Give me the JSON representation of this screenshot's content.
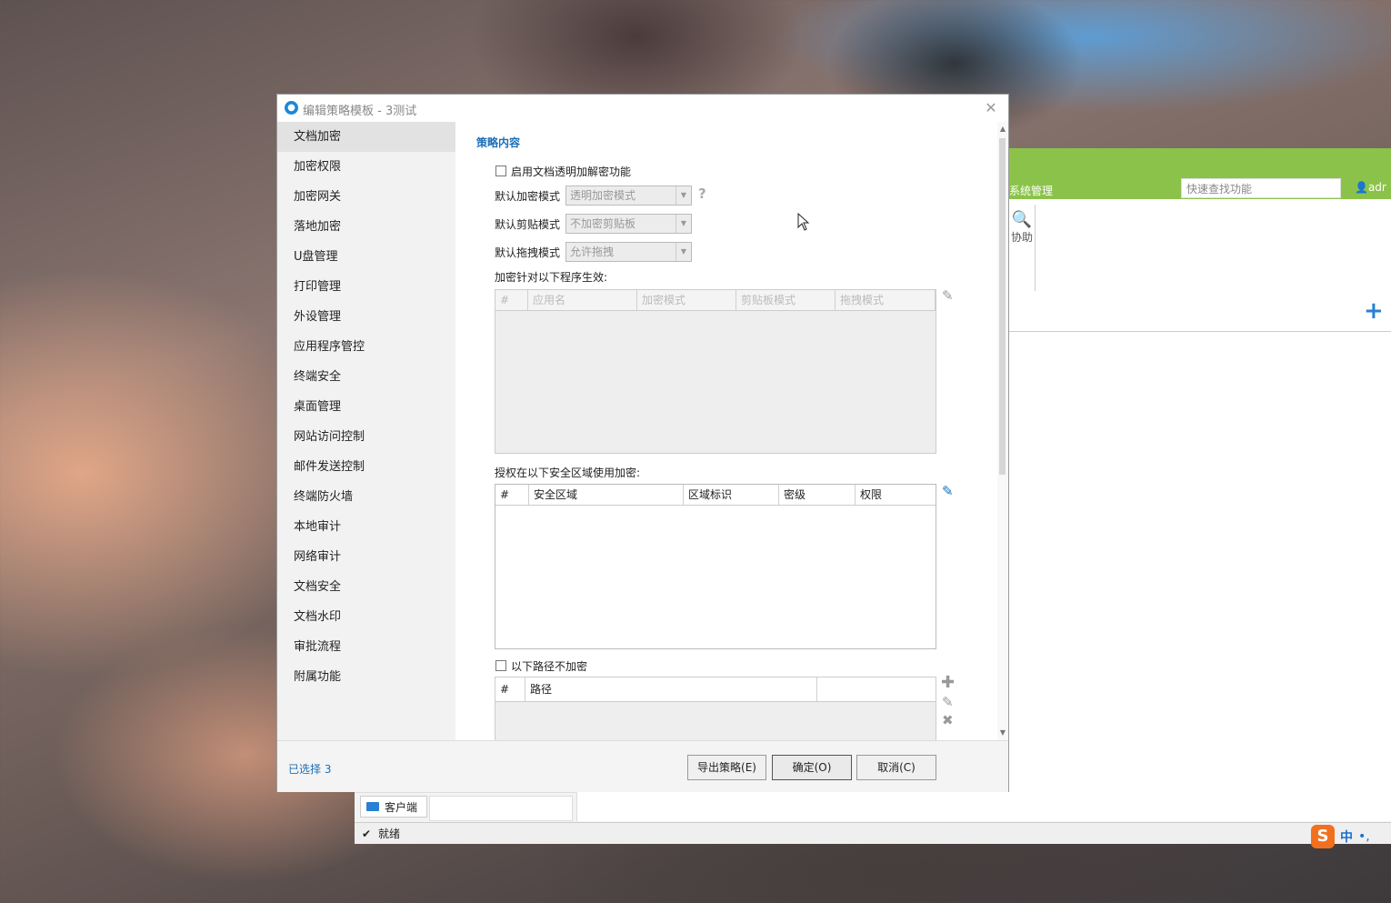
{
  "bg_app": {
    "tab_label": "系统管理",
    "search_placeholder": "快速查找功能",
    "user_label": "adr",
    "help_label": "协助",
    "client_tab": "客户端",
    "status_text": "就绪",
    "ime_brand": "S",
    "ime_lang": "中",
    "ime_punct": "•,"
  },
  "dialog": {
    "title": "编辑策略模板 - 3测试",
    "close_glyph": "✕",
    "nav_items": [
      "文档加密",
      "加密权限",
      "加密网关",
      "落地加密",
      "U盘管理",
      "打印管理",
      "外设管理",
      "应用程序管控",
      "终端安全",
      "桌面管理",
      "网站访问控制",
      "邮件发送控制",
      "终端防火墙",
      "本地审计",
      "网络审计",
      "文档安全",
      "文档水印",
      "审批流程",
      "附属功能"
    ],
    "active_nav": "文档加密",
    "section_title": "策略内容",
    "enable_label": "启用文档透明加解密功能",
    "enc_mode_label": "默认加密模式",
    "enc_mode_value": "透明加密模式",
    "clip_mode_label": "默认剪贴模式",
    "clip_mode_value": "不加密剪贴板",
    "drag_mode_label": "默认拖拽模式",
    "drag_mode_value": "允许拖拽",
    "help_glyph": "?",
    "programs_label": "加密针对以下程序生效:",
    "programs_columns": [
      "#",
      "应用名",
      "加密模式",
      "剪贴板模式",
      "拖拽模式"
    ],
    "zones_label": "授权在以下安全区域使用加密:",
    "zones_columns": [
      "#",
      "安全区域",
      "区域标识",
      "密级",
      "权限"
    ],
    "path_exclude_label": "以下路径不加密",
    "path_columns": [
      "#",
      "路径",
      ""
    ],
    "selected_text": "已选择 3",
    "btn_export": "导出策略(E)",
    "btn_ok": "确定(O)",
    "btn_cancel": "取消(C)"
  }
}
